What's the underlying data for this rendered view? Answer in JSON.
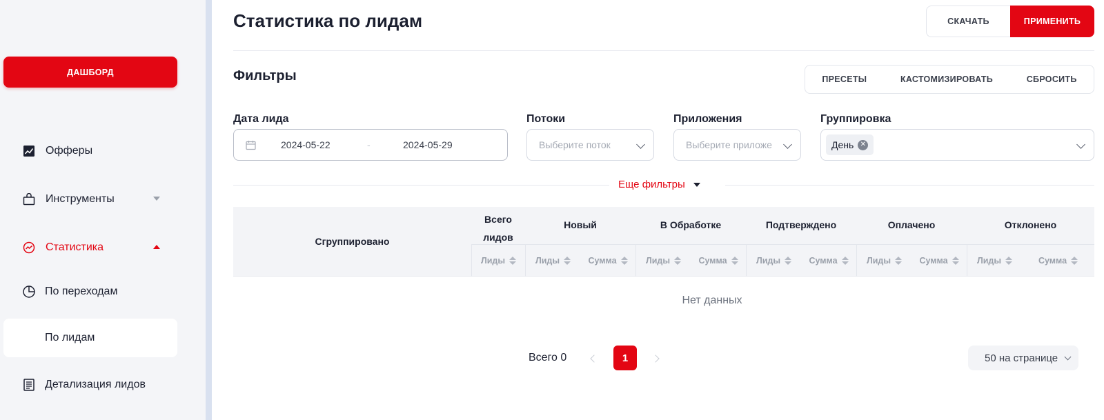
{
  "sidebar": {
    "dashboard_label": "ДАШБОРД",
    "items": [
      {
        "label": "Офферы",
        "icon": "chart-icon"
      },
      {
        "label": "Инструменты",
        "icon": "bag-icon"
      },
      {
        "label": "Статистика",
        "icon": "statistics-icon"
      }
    ],
    "sub_items": [
      {
        "label": "По переходам",
        "icon": "pie-chart-icon"
      },
      {
        "label": "По лидам"
      },
      {
        "label": "Детализация лидов",
        "icon": "document-icon"
      }
    ]
  },
  "header": {
    "title": "Статистика по лидам",
    "download_label": "СКАЧАТЬ",
    "apply_label": "ПРИМЕНИТЬ"
  },
  "filters": {
    "title": "Фильтры",
    "presets_label": "ПРЕСЕТЫ",
    "customize_label": "КАСТОМИЗИРОВАТЬ",
    "reset_label": "СБРОСИТЬ",
    "date": {
      "label": "Дата лида",
      "from": "2024-05-22",
      "separator": "-",
      "to": "2024-05-29"
    },
    "streams": {
      "label": "Потоки",
      "placeholder": "Выберите поток"
    },
    "apps": {
      "label": "Приложения",
      "placeholder": "Выберите приложе"
    },
    "grouping": {
      "label": "Группировка",
      "tag": "День"
    },
    "more_label": "Еще фильтры"
  },
  "table": {
    "grouped_header": "Сгруппировано",
    "total_leads_header_1": "Всего",
    "total_leads_header_2": "лидов",
    "groups": [
      "Новый",
      "В Обработке",
      "Подтверждено",
      "Оплачено",
      "Отклонено"
    ],
    "sub_leads": "Лиды",
    "sub_sum": "Сумма",
    "empty_text": "Нет данных"
  },
  "pagination": {
    "total_label": "Всего 0",
    "current_page": "1",
    "per_page": "50 на странице"
  }
}
